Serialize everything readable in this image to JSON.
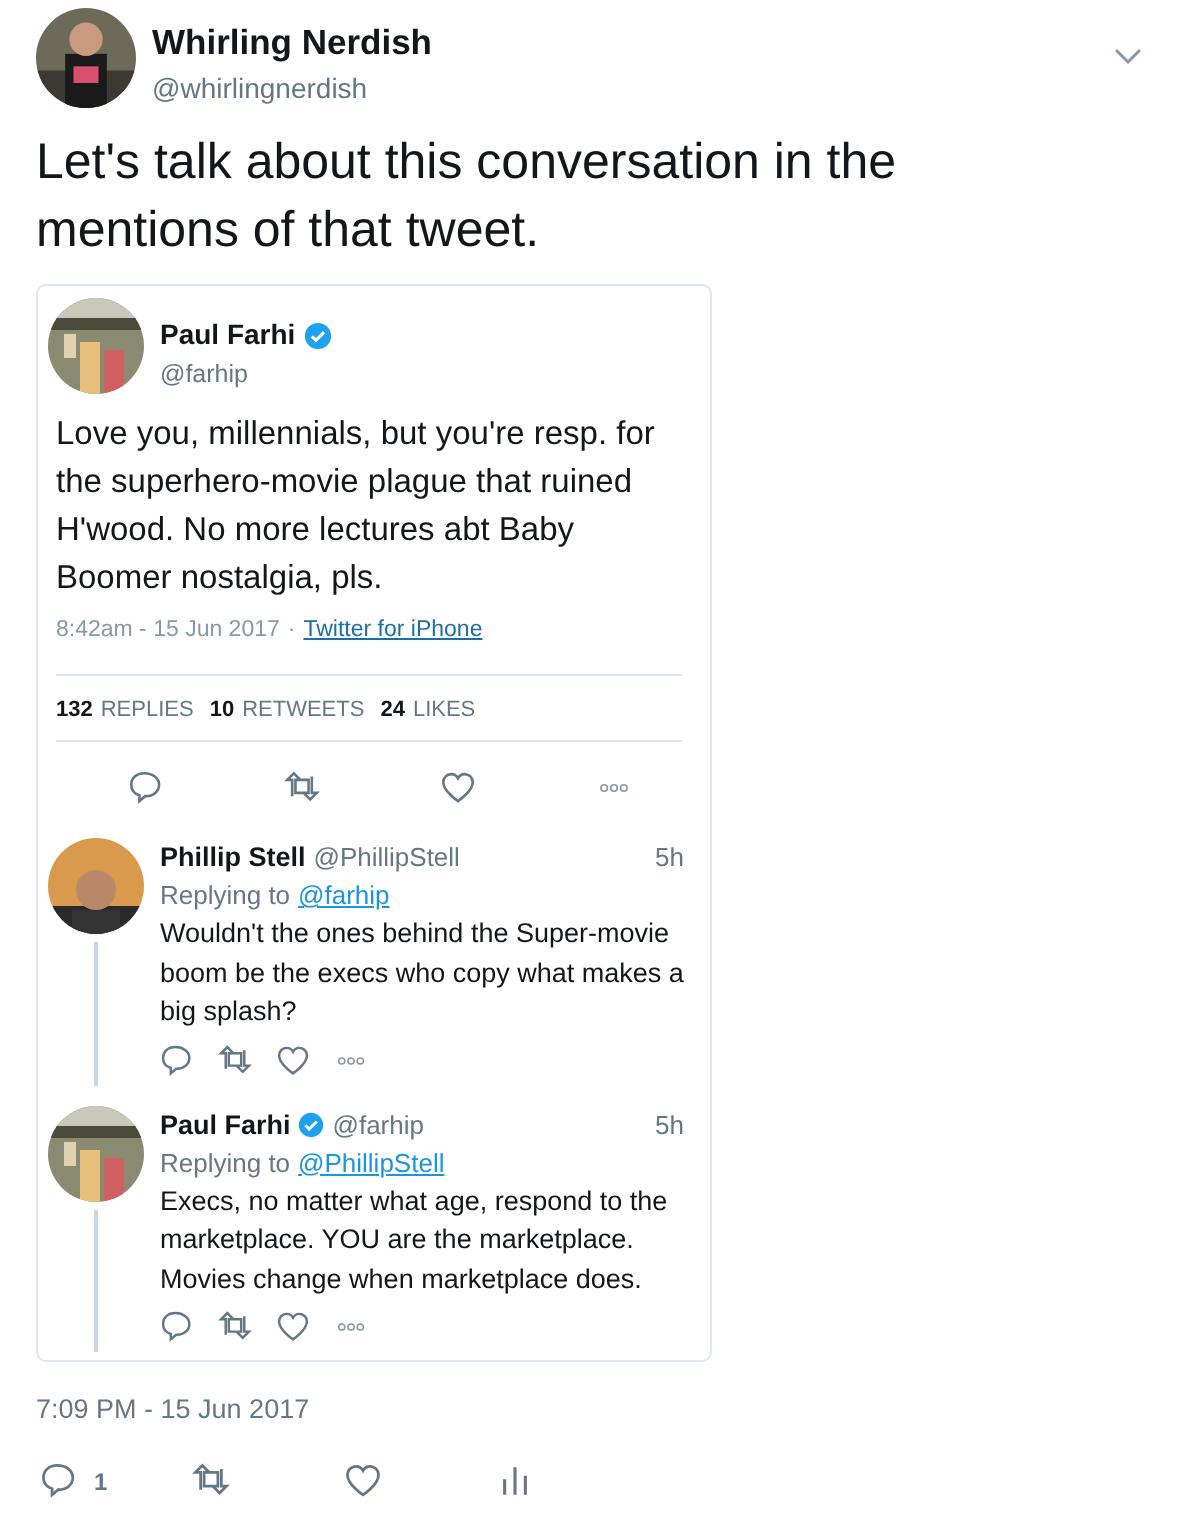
{
  "author": {
    "name": "Whirling Nerdish",
    "handle": "@whirlingnerdish"
  },
  "text": "Let's talk about this conversation in the mentions of that tweet.",
  "embedded": {
    "author": {
      "name": "Paul Farhi",
      "verified": true,
      "handle": "@farhip"
    },
    "text": "Love you, millennials, but you're resp. for the superhero-movie plague that ruined H'wood. No more lectures abt Baby Boomer nostalgia, pls.",
    "time": "8:42am - 15 Jun 2017",
    "separator": "·",
    "source": "Twitter for iPhone",
    "stats": [
      {
        "count": "132",
        "label": "REPLIES"
      },
      {
        "count": "10",
        "label": "RETWEETS"
      },
      {
        "count": "24",
        "label": "LIKES"
      }
    ],
    "actions": [
      {
        "kind": "reply"
      },
      {
        "kind": "retweet"
      },
      {
        "kind": "like"
      },
      {
        "kind": "more"
      }
    ],
    "replies": [
      {
        "name": "Phillip Stell",
        "verified": false,
        "handle": "@PhillipStell",
        "age": "5h",
        "replying_prefix": "Replying to",
        "replying_to": "@farhip",
        "text": "Wouldn't the ones behind the Super-movie boom be the execs who copy what makes a big splash?",
        "actions": [
          {
            "kind": "reply"
          },
          {
            "kind": "retweet"
          },
          {
            "kind": "like"
          },
          {
            "kind": "more"
          }
        ]
      },
      {
        "name": "Paul Farhi",
        "verified": true,
        "handle": "@farhip",
        "age": "5h",
        "replying_prefix": "Replying to",
        "replying_to": "@PhillipStell",
        "text": "Execs, no matter what age, respond to the marketplace. YOU are the marketplace. Movies change when marketplace does.",
        "actions": [
          {
            "kind": "reply"
          },
          {
            "kind": "retweet"
          },
          {
            "kind": "like"
          },
          {
            "kind": "more"
          }
        ]
      }
    ]
  },
  "timestamp": "7:09 PM - 15 Jun 2017",
  "actions": [
    {
      "kind": "reply",
      "count": "1"
    },
    {
      "kind": "retweet"
    },
    {
      "kind": "like"
    },
    {
      "kind": "analytics"
    }
  ]
}
